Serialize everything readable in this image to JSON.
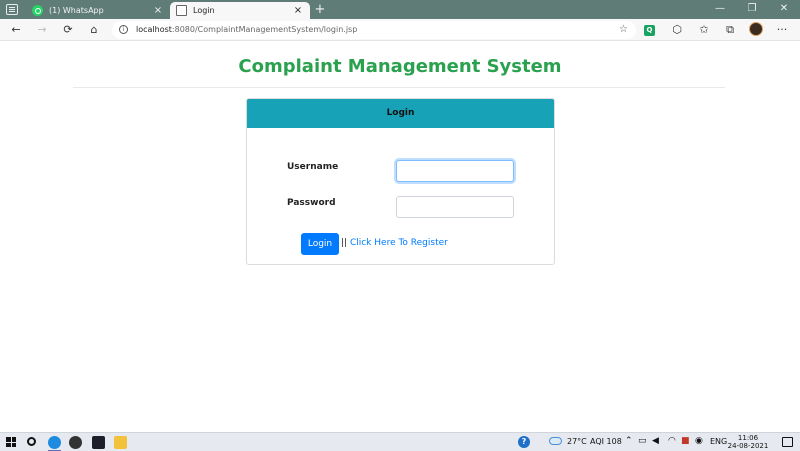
{
  "browser": {
    "tabs": [
      {
        "title": "(1) WhatsApp",
        "close": "×",
        "icon": "whatsapp-icon"
      },
      {
        "title": "Login",
        "close": "×",
        "icon": "page-icon"
      }
    ],
    "new_tab": "+",
    "window_controls": {
      "minimize": "—",
      "restore": "❐",
      "close": "✕"
    },
    "nav": {
      "back": "←",
      "forward": "→",
      "refresh": "⟳",
      "home": "⌂"
    },
    "url": {
      "host": "localhost",
      "path": ":8080/ComplaintManagementSystem/login.jsp"
    },
    "toolbar_icons": {
      "favorite": "☆",
      "extension_letter": "Q",
      "favorites": "✩",
      "collections": "⧉",
      "menu": "···"
    }
  },
  "page": {
    "app_title": "Complaint Management System",
    "card_title": "Login",
    "username_label": "Username",
    "password_label": "Password",
    "username_value": "",
    "password_value": "",
    "login_button": "Login",
    "register_separator": "||",
    "register_link": "Click Here To Register"
  },
  "taskbar": {
    "weather": "27°C",
    "aqi": "AQI 108",
    "language": "ENG",
    "time": "11:06",
    "date": "24-08-2021",
    "help": "?"
  },
  "colors": {
    "title_green": "#2aa14e",
    "card_header": "#17a2b8",
    "primary_button": "#007bff",
    "tabstrip": "#5f7c76"
  }
}
